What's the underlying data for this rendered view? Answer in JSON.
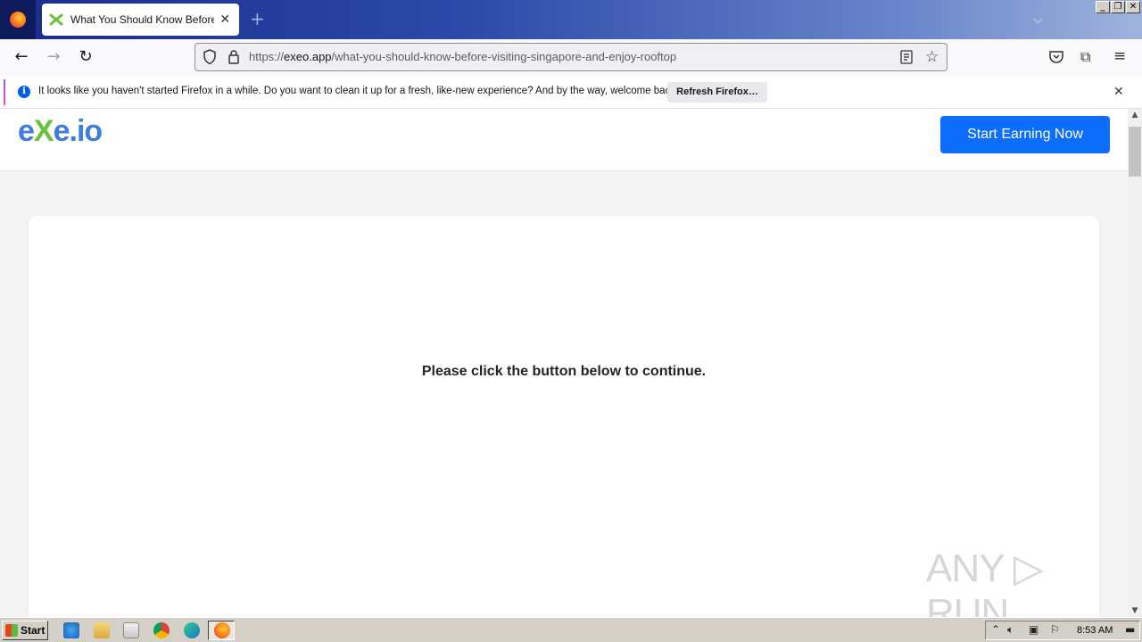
{
  "browser": {
    "tab_title": "What You Should Know Before Visiting Singapore and Enjoy Rooftop",
    "tab_close": "✕",
    "new_tab": "+",
    "url_scheme": "https://",
    "url_host": "exeo.app",
    "url_path": "/what-you-should-know-before-visiting-singapore-and-enjoy-rooftop"
  },
  "notification": {
    "message": "It looks like you haven't started Firefox in a while. Do you want to clean it up for a fresh, like-new experience? And by the way, welcome back!",
    "button_label": "Refresh Firefox…",
    "close": "✕"
  },
  "site": {
    "logo_text_1": "e",
    "logo_text_x": "X",
    "logo_text_2": "e.io",
    "cta_label": "Start Earning Now",
    "message": "Please click the button below to continue.",
    "watermark": "ANY ▷ RUN"
  },
  "taskbar": {
    "start_label": "Start",
    "clock": "8:53 AM"
  },
  "colors": {
    "cta": "#0d6efd",
    "logo_blue": "#3f7de0",
    "logo_green": "#6ac23a"
  }
}
